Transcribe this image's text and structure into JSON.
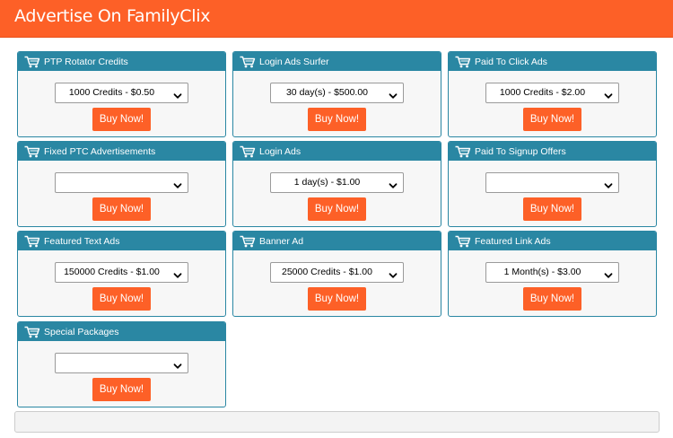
{
  "header": {
    "title": "Advertise On FamilyClix"
  },
  "colors": {
    "accent": "#fd6027",
    "panel": "#2a87a3"
  },
  "icons": {
    "card_icon": "cart-icon",
    "dropdown_icon": "chevron-down-icon"
  },
  "buy_label": "Buy Now!",
  "cards": [
    {
      "title": "PTP Rotator Credits",
      "selected": "1000 Credits - $0.50"
    },
    {
      "title": "Login Ads Surfer",
      "selected": "30 day(s) - $500.00"
    },
    {
      "title": "Paid To Click Ads",
      "selected": "1000 Credits - $2.00"
    },
    {
      "title": "Fixed PTC Advertisements",
      "selected": ""
    },
    {
      "title": "Login Ads",
      "selected": "1 day(s) - $1.00"
    },
    {
      "title": "Paid To Signup Offers",
      "selected": ""
    },
    {
      "title": "Featured Text Ads",
      "selected": "150000 Credits - $1.00"
    },
    {
      "title": "Banner Ad",
      "selected": "25000 Credits - $1.00"
    },
    {
      "title": "Featured Link Ads",
      "selected": "1 Month(s) - $3.00"
    },
    {
      "title": "Special Packages",
      "selected": ""
    }
  ]
}
